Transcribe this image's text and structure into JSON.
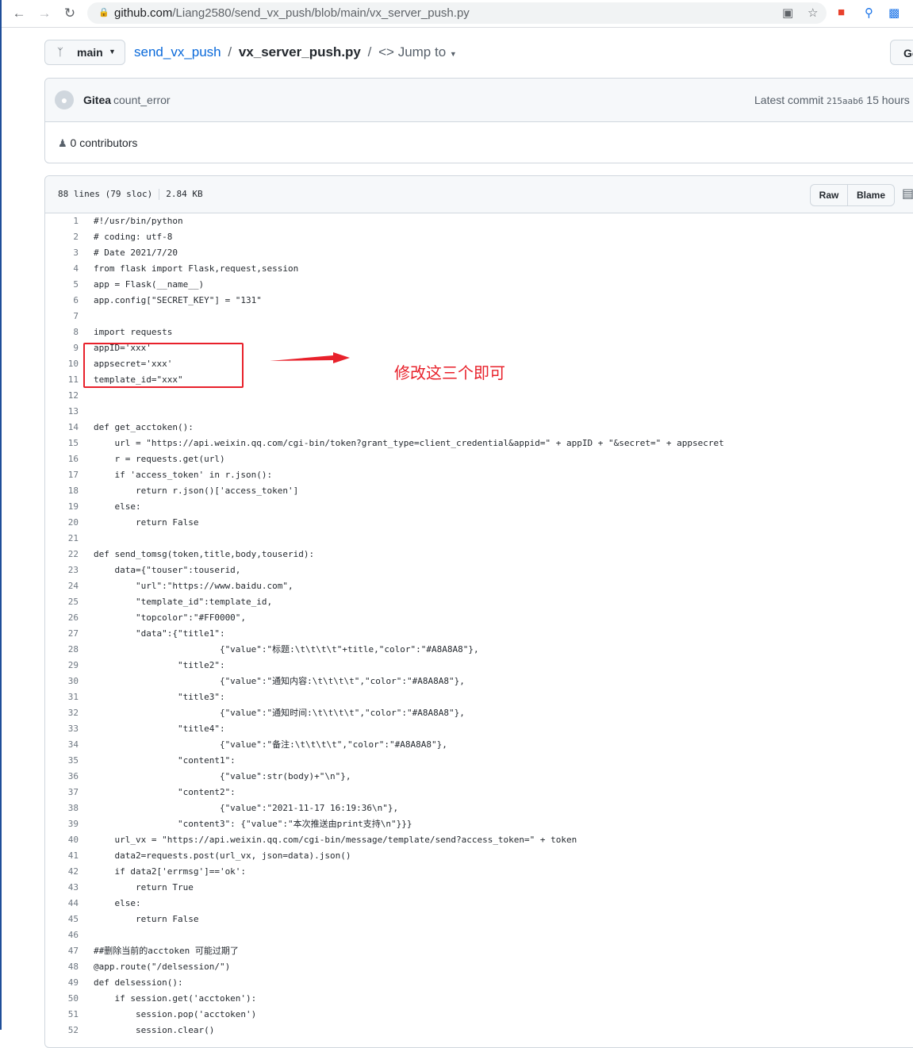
{
  "browser": {
    "url_host": "github.com",
    "url_path": "/Liang2580/send_vx_push/blob/main/vx_server_push.py"
  },
  "repo": {
    "branch": "main",
    "name": "send_vx_push",
    "separator": "/",
    "file": "vx_server_push.py",
    "jump_to": "Jump to",
    "go_button": "Go"
  },
  "commit": {
    "author": "Gitea",
    "message": "count_error",
    "latest_label": "Latest commit",
    "sha": "215aab6",
    "time": "15 hours",
    "contributors": "0 contributors"
  },
  "file": {
    "lines": "88 lines (79 sloc)",
    "size": "2.84 KB",
    "raw": "Raw",
    "blame": "Blame"
  },
  "annotation": {
    "note": "修改这三个即可",
    "color": "#e8212b"
  },
  "code_lines": [
    {
      "n": "1",
      "t": "#!/usr/bin/python"
    },
    {
      "n": "2",
      "t": "# coding: utf-8"
    },
    {
      "n": "3",
      "t": "# Date 2021/7/20"
    },
    {
      "n": "4",
      "t": "from flask import Flask,request,session"
    },
    {
      "n": "5",
      "t": "app = Flask(__name__)"
    },
    {
      "n": "6",
      "t": "app.config[\"SECRET_KEY\"] = \"131\""
    },
    {
      "n": "7",
      "t": ""
    },
    {
      "n": "8",
      "t": "import requests"
    },
    {
      "n": "9",
      "t": "appID='xxx'"
    },
    {
      "n": "10",
      "t": "appsecret='xxx'"
    },
    {
      "n": "11",
      "t": "template_id=\"xxx\""
    },
    {
      "n": "12",
      "t": ""
    },
    {
      "n": "13",
      "t": ""
    },
    {
      "n": "14",
      "t": "def get_acctoken():"
    },
    {
      "n": "15",
      "t": "    url = \"https://api.weixin.qq.com/cgi-bin/token?grant_type=client_credential&appid=\" + appID + \"&secret=\" + appsecret"
    },
    {
      "n": "16",
      "t": "    r = requests.get(url)"
    },
    {
      "n": "17",
      "t": "    if 'access_token' in r.json():"
    },
    {
      "n": "18",
      "t": "        return r.json()['access_token']"
    },
    {
      "n": "19",
      "t": "    else:"
    },
    {
      "n": "20",
      "t": "        return False"
    },
    {
      "n": "21",
      "t": ""
    },
    {
      "n": "22",
      "t": "def send_tomsg(token,title,body,touserid):"
    },
    {
      "n": "23",
      "t": "    data={\"touser\":touserid,"
    },
    {
      "n": "24",
      "t": "        \"url\":\"https://www.baidu.com\","
    },
    {
      "n": "25",
      "t": "        \"template_id\":template_id,"
    },
    {
      "n": "26",
      "t": "        \"topcolor\":\"#FF0000\","
    },
    {
      "n": "27",
      "t": "        \"data\":{\"title1\":"
    },
    {
      "n": "28",
      "t": "                        {\"value\":\"标题:\\t\\t\\t\\t\"+title,\"color\":\"#A8A8A8\"},"
    },
    {
      "n": "29",
      "t": "                \"title2\":"
    },
    {
      "n": "30",
      "t": "                        {\"value\":\"通知内容:\\t\\t\\t\\t\",\"color\":\"#A8A8A8\"},"
    },
    {
      "n": "31",
      "t": "                \"title3\":"
    },
    {
      "n": "32",
      "t": "                        {\"value\":\"通知时间:\\t\\t\\t\\t\",\"color\":\"#A8A8A8\"},"
    },
    {
      "n": "33",
      "t": "                \"title4\":"
    },
    {
      "n": "34",
      "t": "                        {\"value\":\"备注:\\t\\t\\t\\t\",\"color\":\"#A8A8A8\"},"
    },
    {
      "n": "35",
      "t": "                \"content1\":"
    },
    {
      "n": "36",
      "t": "                        {\"value\":str(body)+\"\\n\"},"
    },
    {
      "n": "37",
      "t": "                \"content2\":"
    },
    {
      "n": "38",
      "t": "                        {\"value\":\"2021-11-17 16:19:36\\n\"},"
    },
    {
      "n": "39",
      "t": "                \"content3\": {\"value\":\"本次推送由print支持\\n\"}}}"
    },
    {
      "n": "40",
      "t": "    url_vx = \"https://api.weixin.qq.com/cgi-bin/message/template/send?access_token=\" + token"
    },
    {
      "n": "41",
      "t": "    data2=requests.post(url_vx, json=data).json()"
    },
    {
      "n": "42",
      "t": "    if data2['errmsg']=='ok':"
    },
    {
      "n": "43",
      "t": "        return True"
    },
    {
      "n": "44",
      "t": "    else:"
    },
    {
      "n": "45",
      "t": "        return False"
    },
    {
      "n": "46",
      "t": ""
    },
    {
      "n": "47",
      "t": "##删除当前的acctoken 可能过期了"
    },
    {
      "n": "48",
      "t": "@app.route(\"/delsession/\")"
    },
    {
      "n": "49",
      "t": "def delsession():"
    },
    {
      "n": "50",
      "t": "    if session.get('acctoken'):"
    },
    {
      "n": "51",
      "t": "        session.pop('acctoken')"
    },
    {
      "n": "52",
      "t": "        session.clear()"
    }
  ]
}
